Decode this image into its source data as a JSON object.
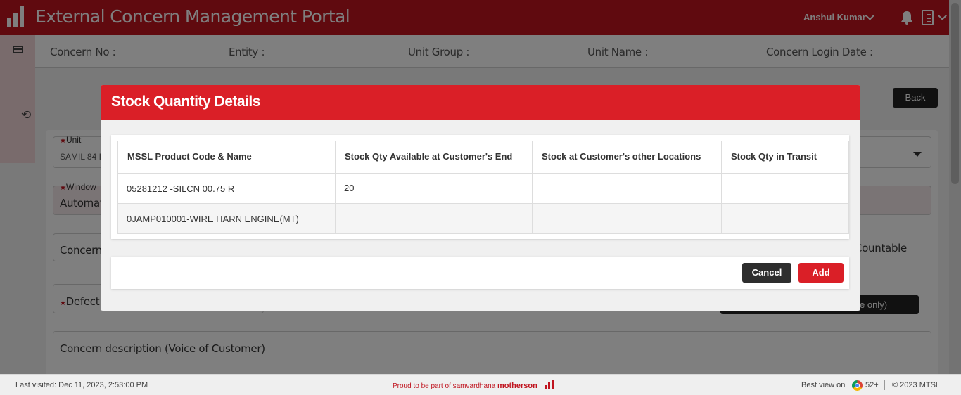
{
  "header": {
    "title": "External Concern Management Portal",
    "user": "Anshul Kumar"
  },
  "infobar": {
    "concern_no": "Concern No :",
    "entity": "Entity :",
    "unit_group": "Unit Group :",
    "unit_name": "Unit Name :",
    "login_date": "Concern Login Date :"
  },
  "back_label": "Back",
  "form": {
    "unit_label": "Unit",
    "unit_value": "SAMIL 84 I",
    "window_label": "Window",
    "window_value": "Automat",
    "concern_partial": "Concern",
    "countable_partial": "Countable",
    "defect_partial": "Defect",
    "dark_btn_partial": "e only)",
    "description_label": "Concern description (Voice of Customer)"
  },
  "modal": {
    "title": "Stock Quantity Details",
    "columns": [
      "MSSL Product Code & Name",
      "Stock Qty Available at Customer's End",
      "Stock at Customer's other Locations",
      "Stock Qty in Transit"
    ],
    "rows": [
      {
        "product": "05281212 -SILCN 00.75 R",
        "available": "20",
        "other": "",
        "transit": ""
      },
      {
        "product": "0JAMP010001-WIRE HARN ENGINE(MT)",
        "available": "",
        "other": "",
        "transit": ""
      }
    ],
    "cancel_label": "Cancel",
    "add_label": "Add"
  },
  "footer": {
    "last_visited": "Last visited: Dec 11, 2023, 2:53:00 PM",
    "proud_text": "Proud to be part of samvardhana",
    "brand": "motherson",
    "best_view": "Best view on",
    "version": "52+",
    "copyright": "© 2023 MTSL"
  },
  "colors": {
    "brand_red": "#c0141f",
    "modal_red": "#da1f27",
    "dark_button": "#2e2e2e"
  }
}
